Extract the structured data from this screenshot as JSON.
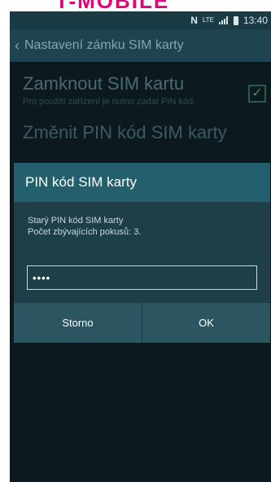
{
  "brand": {
    "text": "T-MOBILE"
  },
  "status_bar": {
    "nfc_icon": "N",
    "network": "LTE",
    "time": "13:40"
  },
  "action_bar": {
    "back_icon": "chevron-left",
    "title": "Nastavení zámku SIM karty"
  },
  "settings": {
    "lock_sim": {
      "title": "Zamknout SIM kartu",
      "subtitle": "Pro použití zařízení je nutno zadat PIN kód.",
      "checked": true
    },
    "change_pin": {
      "title": "Změnit PIN kód SIM karty"
    }
  },
  "dialog": {
    "title": "PIN kód SIM karty",
    "message_line1": "Starý PIN kód SIM karty",
    "message_line2": "Počet zbývajících pokusů: 3.",
    "pin_value": "••••",
    "cancel_label": "Storno",
    "ok_label": "OK"
  },
  "colors": {
    "brand": "#e2007a",
    "dialog_title_bg": "#245f6d",
    "dialog_bg": "#1f3f48",
    "check": "#3d8f5c"
  }
}
